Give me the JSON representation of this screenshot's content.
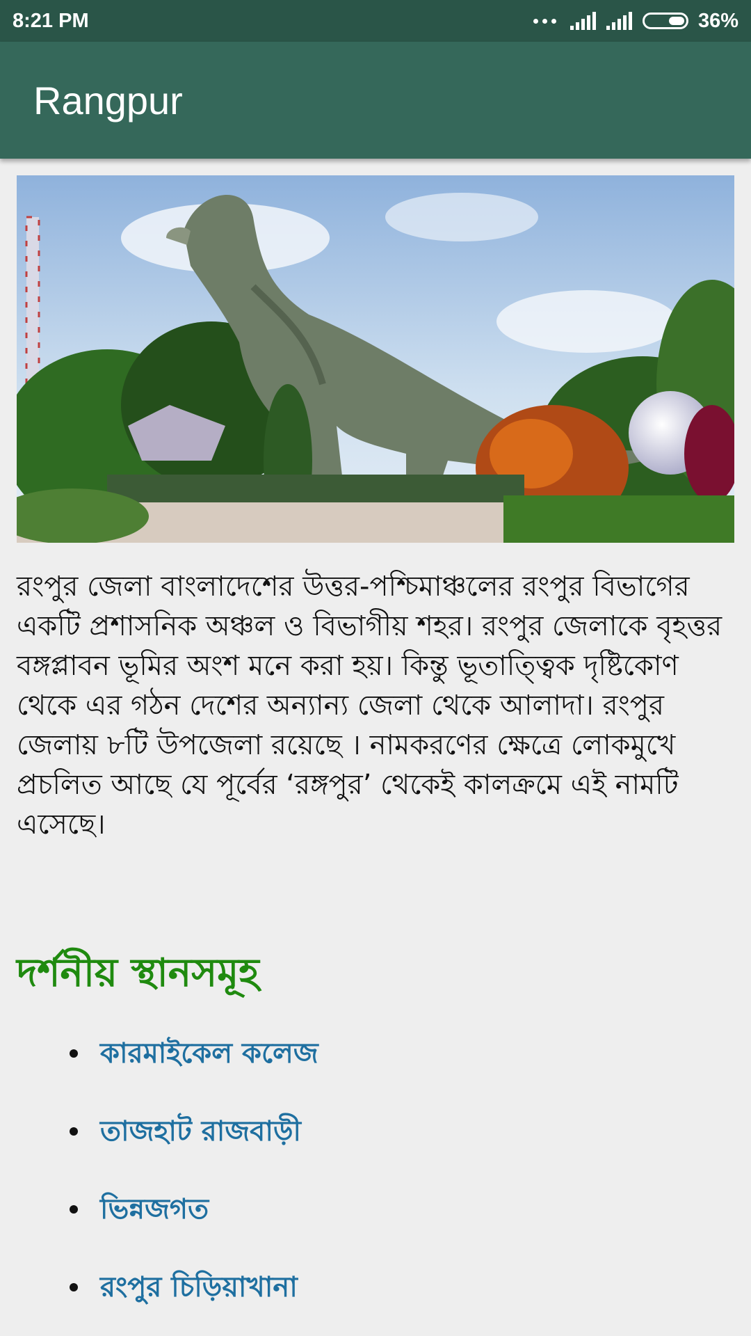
{
  "status_bar": {
    "time": "8:21 PM",
    "battery": "36%"
  },
  "app_bar": {
    "title": "Rangpur"
  },
  "hero": {
    "icon": "hero-image"
  },
  "description": "রংপুর জেলা বাংলাদেশের উত্তর-পশ্চিমাঞ্চলের রংপুর বিভাগের একটি প্রশাসনিক অঞ্চল ও বিভাগীয় শহর। রংপুর জেলাকে বৃহত্তর বঙ্গপ্লাবন ভূমির অংশ মনে করা হয়। কিন্তু ভূতাত্ত্বিক দৃষ্টিকোণ থেকে এর গঠন দেশের অন্যান্য জেলা থেকে আলাদা। রংপুর জেলায় ৮টি উপজেলা রয়েছে । নামকরণের ক্ষেত্রে লোকমুখে প্রচলিত আছে যে পূর্বের ‘রঙ্গপুর’ থেকেই কালক্রমে এই নামটি এসেছে।",
  "section": {
    "heading": "দর্শনীয় স্থানসমূহ",
    "items": [
      {
        "label": "কারমাইকেল কলেজ"
      },
      {
        "label": "তাজহাট রাজবাড়ী"
      },
      {
        "label": "ভিন্নজগত"
      },
      {
        "label": "রংপুর চিড়িয়াখানা"
      }
    ]
  },
  "colors": {
    "status_bar": "#2a5548",
    "app_bar": "#35685a",
    "heading": "#1f8a0f",
    "link": "#1e6fa0",
    "background": "#eeeeee"
  }
}
